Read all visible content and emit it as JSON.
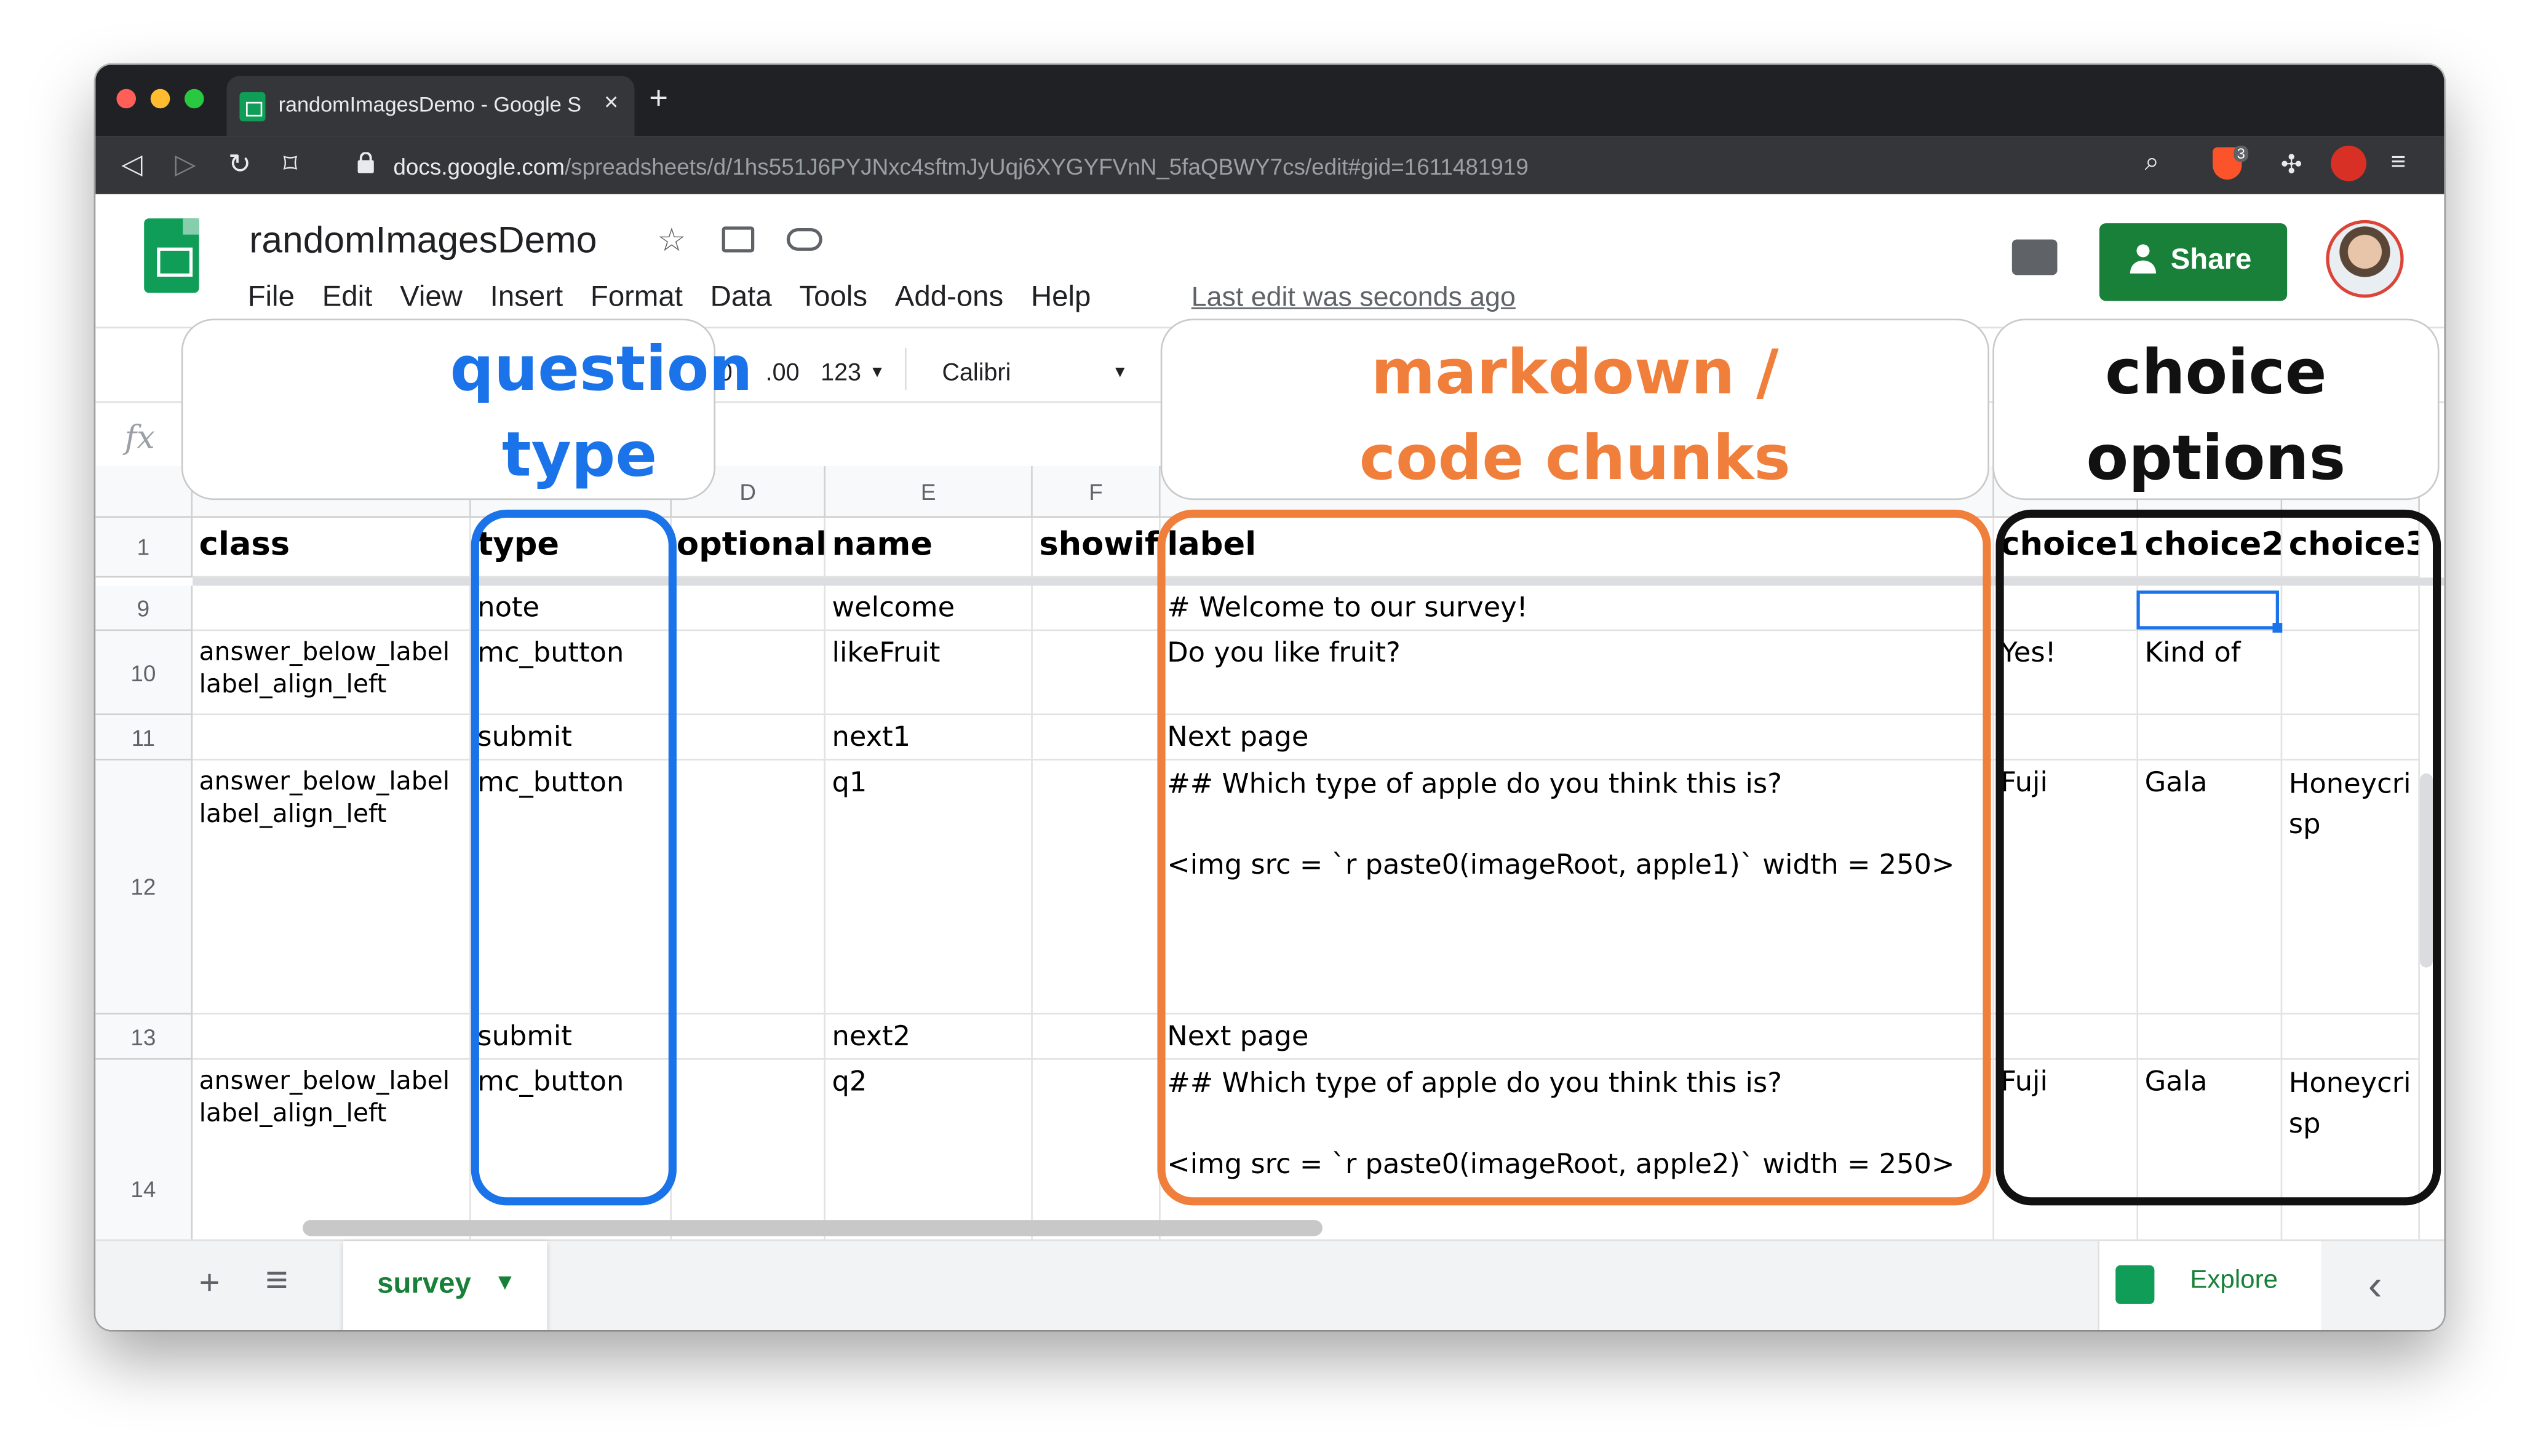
{
  "browser": {
    "tab_title": "randomImagesDemo - Google S",
    "tab_close": "×",
    "new_tab": "+",
    "url_host": "docs.google.com",
    "url_path": "/spreadsheets/d/1hs551J6PYJNxc4sftmJyUqj6XYGYFVnN_5faQBWY7cs/edit#gid=1611481919",
    "shield_badge": "3"
  },
  "sheets": {
    "doc_title": "randomImagesDemo",
    "menu": [
      "File",
      "Edit",
      "View",
      "Insert",
      "Format",
      "Data",
      "Tools",
      "Add-ons",
      "Help"
    ],
    "last_edit": "Last edit was seconds ago",
    "share_label": "Share",
    "toolbar": {
      "decrease_decimals": ".0",
      "increase_decimals": ".00",
      "more_formats": "123",
      "font": "Calibri"
    },
    "fx": "fx"
  },
  "grid": {
    "col_letters": [
      "D",
      "E",
      "F"
    ],
    "headers": [
      "class",
      "type",
      "optional",
      "name",
      "showif",
      "label",
      "choice1",
      "choice2",
      "choice3"
    ],
    "rows": [
      {
        "num": "1"
      },
      {
        "num": "9",
        "class": "",
        "type": "note",
        "optional": "",
        "name": "welcome",
        "showif": "",
        "label": "# Welcome to our survey!",
        "choice1": "",
        "choice2": "",
        "choice3": ""
      },
      {
        "num": "10",
        "class": "answer_below_label\nlabel_align_left",
        "type": "mc_button",
        "optional": "",
        "name": "likeFruit",
        "showif": "",
        "label": "Do you like fruit?",
        "choice1": "Yes!",
        "choice2": "Kind of",
        "choice3": ""
      },
      {
        "num": "11",
        "class": "",
        "type": "submit",
        "optional": "",
        "name": "next1",
        "showif": "",
        "label": "Next page",
        "choice1": "",
        "choice2": "",
        "choice3": ""
      },
      {
        "num": "12",
        "class": "answer_below_label\nlabel_align_left",
        "type": "mc_button",
        "optional": "",
        "name": "q1",
        "showif": "",
        "label": "## Which type of apple do you think this is?\n\n<img src = `r paste0(imageRoot, apple1)` width = 250>",
        "choice1": "Fuji",
        "choice2": "Gala",
        "choice3": "Honeycri\nsp"
      },
      {
        "num": "13",
        "class": "",
        "type": "submit",
        "optional": "",
        "name": "next2",
        "showif": "",
        "label": "Next page",
        "choice1": "",
        "choice2": "",
        "choice3": ""
      },
      {
        "num": "14",
        "class": "answer_below_label\nlabel_align_left",
        "type": "mc_button",
        "optional": "",
        "name": "q2",
        "showif": "",
        "label": "## Which type of apple do you think this is?\n\n<img src = `r paste0(imageRoot, apple2)` width = 250>",
        "choice1": "Fuji",
        "choice2": "Gala",
        "choice3": "Honeycri\nsp"
      }
    ]
  },
  "bottom": {
    "add_sheet": "+",
    "all_sheets": "≡",
    "sheet_name": "survey",
    "sheet_caret": "▼",
    "explore": "Explore",
    "collapse": "‹"
  },
  "annotations": {
    "question_type": "question\ntype",
    "markdown": "markdown /\ncode chunks",
    "choice_options": "choice\noptions",
    "colors": {
      "question_type": "#1a73e8",
      "markdown": "#f07f3c",
      "choice_options": "#111111"
    }
  }
}
